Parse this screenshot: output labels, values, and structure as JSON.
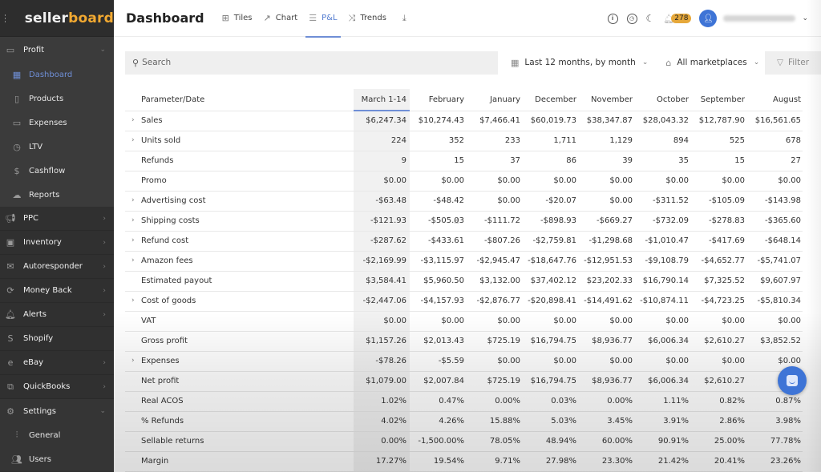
{
  "sidebar": {
    "logo": {
      "part1": "seller",
      "part2": "board"
    },
    "profit": {
      "label": "Profit",
      "items": [
        {
          "label": "Dashboard",
          "icon": "dashboard-icon",
          "active": true
        },
        {
          "label": "Products",
          "icon": "clipboard-icon"
        },
        {
          "label": "Expenses",
          "icon": "card-icon"
        },
        {
          "label": "LTV",
          "icon": "clock-icon"
        },
        {
          "label": "Cashflow",
          "icon": "dollar-icon"
        },
        {
          "label": "Reports",
          "icon": "cloud-download-icon"
        }
      ]
    },
    "sections": [
      {
        "label": "PPC",
        "icon": "megaphone-icon"
      },
      {
        "label": "Inventory",
        "icon": "box-icon"
      },
      {
        "label": "Autoresponder",
        "icon": "mail-icon"
      },
      {
        "label": "Money Back",
        "icon": "refresh-icon"
      },
      {
        "label": "Alerts",
        "icon": "bell-icon"
      },
      {
        "label": "Shopify",
        "icon": "shopify-icon"
      },
      {
        "label": "eBay",
        "icon": "ebay-icon"
      },
      {
        "label": "QuickBooks",
        "icon": "quickbooks-icon"
      }
    ],
    "settings": {
      "label": "Settings",
      "items": [
        {
          "label": "General",
          "icon": "sliders-icon"
        },
        {
          "label": "Users",
          "icon": "users-icon"
        }
      ]
    }
  },
  "header": {
    "title": "Dashboard",
    "tabs": [
      {
        "label": "Tiles",
        "icon": "grid-icon"
      },
      {
        "label": "Chart",
        "icon": "trend-line-icon"
      },
      {
        "label": "P&L",
        "icon": "table-icon",
        "active": true
      },
      {
        "label": "Trends",
        "icon": "shuffle-icon"
      }
    ],
    "notification_count": "278"
  },
  "filters": {
    "search_placeholder": "Search",
    "period": "Last 12 months, by month",
    "marketplace": "All marketplaces",
    "filter_label": "Filter"
  },
  "table": {
    "header_param": "Parameter/Date",
    "columns": [
      "March 1-14",
      "February",
      "January",
      "December",
      "November",
      "October",
      "September",
      "August"
    ],
    "rows": [
      {
        "label": "Sales",
        "expandable": true,
        "values": [
          "$6,247.34",
          "$10,274.43",
          "$7,466.41",
          "$60,019.73",
          "$38,347.87",
          "$28,043.32",
          "$12,787.90",
          "$16,561.65"
        ]
      },
      {
        "label": "Units sold",
        "expandable": true,
        "values": [
          "224",
          "352",
          "233",
          "1,711",
          "1,129",
          "894",
          "525",
          "678"
        ]
      },
      {
        "label": "Refunds",
        "expandable": false,
        "values": [
          "9",
          "15",
          "37",
          "86",
          "39",
          "35",
          "15",
          "27"
        ]
      },
      {
        "label": "Promo",
        "expandable": false,
        "values": [
          "$0.00",
          "$0.00",
          "$0.00",
          "$0.00",
          "$0.00",
          "$0.00",
          "$0.00",
          "$0.00"
        ]
      },
      {
        "label": "Advertising cost",
        "expandable": true,
        "values": [
          "-$63.48",
          "-$48.42",
          "$0.00",
          "-$20.07",
          "$0.00",
          "-$311.52",
          "-$105.09",
          "-$143.98"
        ]
      },
      {
        "label": "Shipping costs",
        "expandable": true,
        "values": [
          "-$121.93",
          "-$505.03",
          "-$111.72",
          "-$898.93",
          "-$669.27",
          "-$732.09",
          "-$278.83",
          "-$365.60"
        ]
      },
      {
        "label": "Refund cost",
        "expandable": true,
        "values": [
          "-$287.62",
          "-$433.61",
          "-$807.26",
          "-$2,759.81",
          "-$1,298.68",
          "-$1,010.47",
          "-$417.69",
          "-$648.14"
        ]
      },
      {
        "label": "Amazon fees",
        "expandable": true,
        "values": [
          "-$2,169.99",
          "-$3,115.97",
          "-$2,945.47",
          "-$18,647.76",
          "-$12,951.53",
          "-$9,108.79",
          "-$4,652.77",
          "-$5,741.07"
        ]
      },
      {
        "label": "Estimated payout",
        "expandable": false,
        "values": [
          "$3,584.41",
          "$5,960.50",
          "$3,132.00",
          "$37,402.12",
          "$23,202.33",
          "$16,790.14",
          "$7,325.52",
          "$9,607.97"
        ]
      },
      {
        "label": "Cost of goods",
        "expandable": true,
        "values": [
          "-$2,447.06",
          "-$4,157.93",
          "-$2,876.77",
          "-$20,898.41",
          "-$14,491.62",
          "-$10,874.11",
          "-$4,723.25",
          "-$5,810.34"
        ]
      },
      {
        "label": "VAT",
        "expandable": false,
        "values": [
          "$0.00",
          "$0.00",
          "$0.00",
          "$0.00",
          "$0.00",
          "$0.00",
          "$0.00",
          "$0.00"
        ]
      },
      {
        "label": "Gross profit",
        "expandable": false,
        "values": [
          "$1,157.26",
          "$2,013.43",
          "$725.19",
          "$16,794.75",
          "$8,936.77",
          "$6,006.34",
          "$2,610.27",
          "$3,852.52"
        ]
      },
      {
        "label": "Expenses",
        "expandable": true,
        "values": [
          "-$78.26",
          "-$5.59",
          "$0.00",
          "$0.00",
          "$0.00",
          "$0.00",
          "$0.00",
          "$0.00"
        ]
      },
      {
        "label": "Net profit",
        "expandable": false,
        "values": [
          "$1,079.00",
          "$2,007.84",
          "$725.19",
          "$16,794.75",
          "$8,936.77",
          "$6,006.34",
          "$2,610.27",
          "$3,8"
        ]
      },
      {
        "label": "Real ACOS",
        "expandable": false,
        "values": [
          "1.02%",
          "0.47%",
          "0.00%",
          "0.03%",
          "0.00%",
          "1.11%",
          "0.82%",
          "0.87%"
        ]
      },
      {
        "label": "% Refunds",
        "expandable": false,
        "values": [
          "4.02%",
          "4.26%",
          "15.88%",
          "5.03%",
          "3.45%",
          "3.91%",
          "2.86%",
          "3.98%"
        ]
      },
      {
        "label": "Sellable returns",
        "expandable": false,
        "values": [
          "0.00%",
          "-1,500.00%",
          "78.05%",
          "48.94%",
          "60.00%",
          "90.91%",
          "25.00%",
          "77.78%"
        ]
      },
      {
        "label": "Margin",
        "expandable": false,
        "values": [
          "17.27%",
          "19.54%",
          "9.71%",
          "27.98%",
          "23.30%",
          "21.42%",
          "20.41%",
          "23.26%"
        ]
      }
    ]
  },
  "colors": {
    "accent": "#6f8fd6",
    "brand_orange": "#f2a931",
    "badge": "#e6a83a",
    "avatar": "#3e74d6",
    "sidebar_bg": "#303030"
  }
}
